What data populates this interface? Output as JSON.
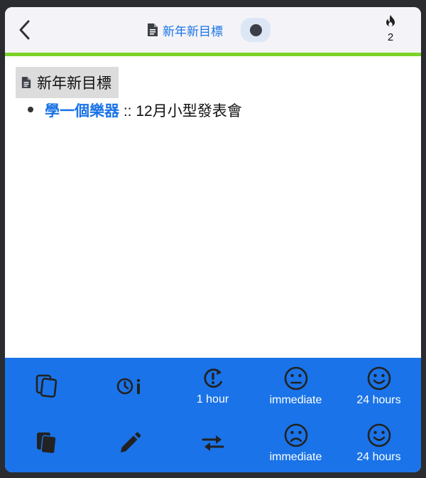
{
  "header": {
    "title": "新年新目標",
    "streak_count": "2",
    "progress_percent": 100,
    "progress_color": "#7bd22a"
  },
  "note": {
    "heading": "新年新目標",
    "items": [
      {
        "link": "學一個樂器",
        "rest": " :: 12月小型發表會"
      }
    ]
  },
  "toolbar": {
    "row1": [
      {
        "icon": "copy-outline-icon",
        "label": ""
      },
      {
        "icon": "clock-info-icon",
        "label": ""
      },
      {
        "icon": "repeat-alert-icon",
        "label": "1 hour"
      },
      {
        "icon": "face-neutral-icon",
        "label": "immediate"
      },
      {
        "icon": "face-smile-icon",
        "label": "24 hours"
      }
    ],
    "row2": [
      {
        "icon": "copy-filled-icon",
        "label": ""
      },
      {
        "icon": "pencil-icon",
        "label": ""
      },
      {
        "icon": "swap-arrows-icon",
        "label": ""
      },
      {
        "icon": "face-sad-icon",
        "label": "immediate"
      },
      {
        "icon": "face-smile-icon",
        "label": "24 hours"
      }
    ]
  },
  "colors": {
    "accent": "#1a73e8",
    "toolbar_bg": "#1a73e8",
    "header_bg": "#f4f4f8"
  }
}
